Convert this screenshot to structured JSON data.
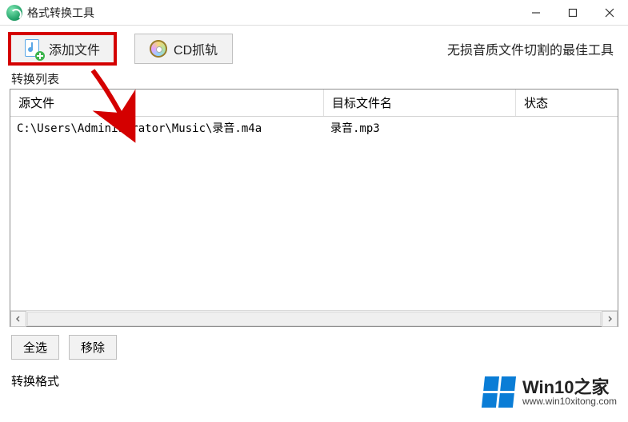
{
  "window": {
    "title": "格式转换工具"
  },
  "toolbar": {
    "add_file_label": "添加文件",
    "cd_rip_label": "CD抓轨",
    "tagline": "无损音质文件切割的最佳工具"
  },
  "list": {
    "section_label": "转换列表",
    "columns": {
      "source": "源文件",
      "target": "目标文件名",
      "status": "状态"
    },
    "rows": [
      {
        "source": "C:\\Users\\Administrator\\Music\\录音.m4a",
        "target": "录音.mp3",
        "status": ""
      }
    ]
  },
  "actions": {
    "select_all": "全选",
    "remove": "移除"
  },
  "bottom": {
    "format_section_label": "转换格式"
  },
  "watermark": {
    "main": "Win10之家",
    "url": "www.win10xitong.com"
  }
}
